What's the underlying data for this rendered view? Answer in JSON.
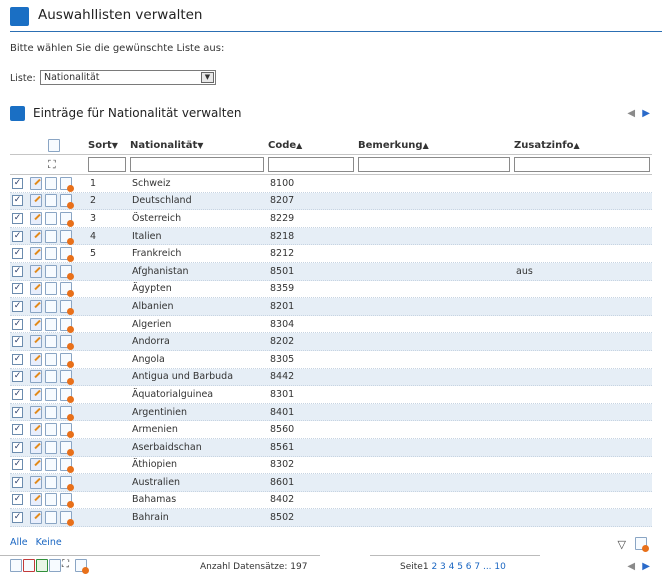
{
  "page": {
    "title": "Auswahllisten verwalten",
    "prompt": "Bitte wählen Sie die gewünschte Liste aus:",
    "liste_label": "Liste:",
    "liste_value": "Nationalität"
  },
  "section": {
    "title": "Einträge für Nationalität verwalten"
  },
  "columns": {
    "sort": "Sort",
    "nationalitaet": "Nationalität",
    "code": "Code",
    "bemerkung": "Bemerkung",
    "zusatzinfo": "Zusatzinfo"
  },
  "rows": [
    {
      "sort": "1",
      "name": "Schweiz",
      "code": "8100",
      "bemerkung": "",
      "zusatz": ""
    },
    {
      "sort": "2",
      "name": "Deutschland",
      "code": "8207",
      "bemerkung": "",
      "zusatz": ""
    },
    {
      "sort": "3",
      "name": "Österreich",
      "code": "8229",
      "bemerkung": "",
      "zusatz": ""
    },
    {
      "sort": "4",
      "name": "Italien",
      "code": "8218",
      "bemerkung": "",
      "zusatz": ""
    },
    {
      "sort": "5",
      "name": "Frankreich",
      "code": "8212",
      "bemerkung": "",
      "zusatz": ""
    },
    {
      "sort": "",
      "name": "Afghanistan",
      "code": "8501",
      "bemerkung": "",
      "zusatz": "aus"
    },
    {
      "sort": "",
      "name": "Ägypten",
      "code": "8359",
      "bemerkung": "",
      "zusatz": ""
    },
    {
      "sort": "",
      "name": "Albanien",
      "code": "8201",
      "bemerkung": "",
      "zusatz": ""
    },
    {
      "sort": "",
      "name": "Algerien",
      "code": "8304",
      "bemerkung": "",
      "zusatz": ""
    },
    {
      "sort": "",
      "name": "Andorra",
      "code": "8202",
      "bemerkung": "",
      "zusatz": ""
    },
    {
      "sort": "",
      "name": "Angola",
      "code": "8305",
      "bemerkung": "",
      "zusatz": ""
    },
    {
      "sort": "",
      "name": "Antigua und Barbuda",
      "code": "8442",
      "bemerkung": "",
      "zusatz": ""
    },
    {
      "sort": "",
      "name": "Äquatorialguinea",
      "code": "8301",
      "bemerkung": "",
      "zusatz": ""
    },
    {
      "sort": "",
      "name": "Argentinien",
      "code": "8401",
      "bemerkung": "",
      "zusatz": ""
    },
    {
      "sort": "",
      "name": "Armenien",
      "code": "8560",
      "bemerkung": "",
      "zusatz": ""
    },
    {
      "sort": "",
      "name": "Aserbaidschan",
      "code": "8561",
      "bemerkung": "",
      "zusatz": ""
    },
    {
      "sort": "",
      "name": "Äthiopien",
      "code": "8302",
      "bemerkung": "",
      "zusatz": ""
    },
    {
      "sort": "",
      "name": "Australien",
      "code": "8601",
      "bemerkung": "",
      "zusatz": ""
    },
    {
      "sort": "",
      "name": "Bahamas",
      "code": "8402",
      "bemerkung": "",
      "zusatz": ""
    },
    {
      "sort": "",
      "name": "Bahrain",
      "code": "8502",
      "bemerkung": "",
      "zusatz": ""
    }
  ],
  "footer": {
    "alle": "Alle",
    "keine": "Keine",
    "count_label": "Anzahl Datensätze: 197",
    "seite_label": "Seite",
    "current_page": "1",
    "other_pages": "2 3 4 5 6 7 ... 10"
  },
  "colors": {
    "accent": "#1a6fc4",
    "link": "#1a66c2",
    "row_alt": "#e6eef6"
  }
}
